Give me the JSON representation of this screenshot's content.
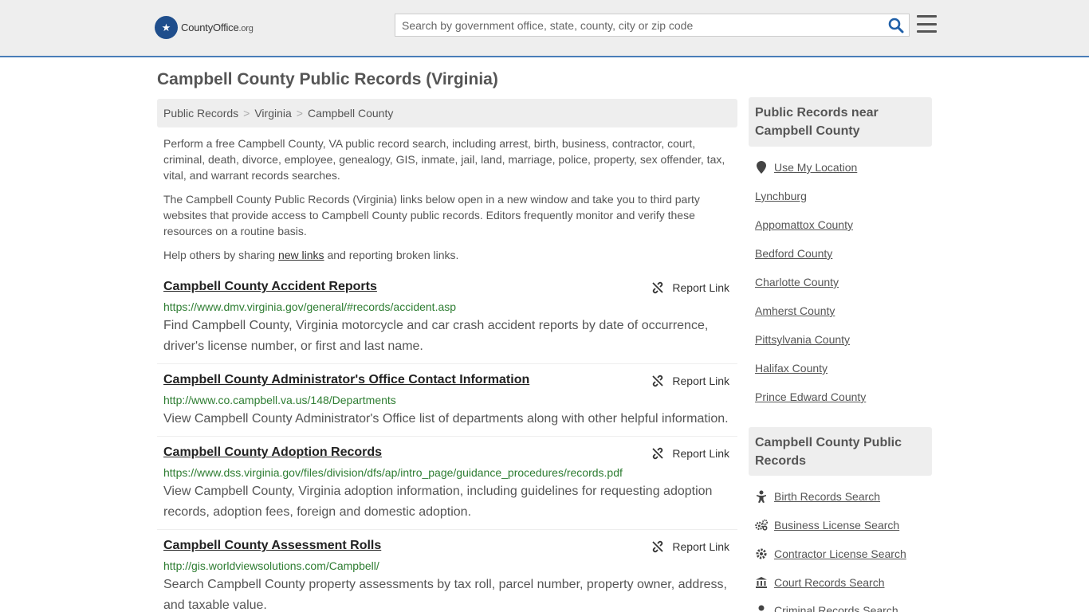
{
  "header": {
    "logo_text": "CountyOffice",
    "logo_suffix": ".org",
    "search_placeholder": "Search by government office, state, county, city or zip code"
  },
  "page_title": "Campbell County Public Records (Virginia)",
  "breadcrumb": [
    "Public Records",
    "Virginia",
    "Campbell County"
  ],
  "intro": {
    "p1": "Perform a free Campbell County, VA public record search, including arrest, birth, business, contractor, court, criminal, death, divorce, employee, genealogy, GIS, inmate, jail, land, marriage, police, property, sex offender, tax, vital, and warrant records searches.",
    "p2": "The Campbell County Public Records (Virginia) links below open in a new window and take you to third party websites that provide access to Campbell County public records. Editors frequently monitor and verify these resources on a routine basis.",
    "p3_before": "Help others by sharing ",
    "p3_link": "new links",
    "p3_after": " and reporting broken links."
  },
  "report_label": "Report Link",
  "entries": [
    {
      "title": "Campbell County Accident Reports",
      "url": "https://www.dmv.virginia.gov/general/#records/accident.asp",
      "desc": "Find Campbell County, Virginia motorcycle and car crash accident reports by date of occurrence, driver's license number, or first and last name."
    },
    {
      "title": "Campbell County Administrator's Office Contact Information",
      "url": "http://www.co.campbell.va.us/148/Departments",
      "desc": "View Campbell County Administrator's Office list of departments along with other helpful information."
    },
    {
      "title": "Campbell County Adoption Records",
      "url": "https://www.dss.virginia.gov/files/division/dfs/ap/intro_page/guidance_procedures/records.pdf",
      "desc": "View Campbell County, Virginia adoption information, including guidelines for requesting adoption records, adoption fees, foreign and domestic adoption."
    },
    {
      "title": "Campbell County Assessment Rolls",
      "url": "http://gis.worldviewsolutions.com/Campbell/",
      "desc": "Search Campbell County property assessments by tax roll, parcel number, property owner, address, and taxable value."
    }
  ],
  "sidebar": {
    "near_title": "Public Records near Campbell County",
    "use_location": "Use My Location",
    "near_links": [
      "Lynchburg",
      "Appomattox County",
      "Bedford County",
      "Charlotte County",
      "Amherst County",
      "Pittsylvania County",
      "Halifax County",
      "Prince Edward County"
    ],
    "records_title": "Campbell County Public Records",
    "record_links": [
      {
        "label": "Birth Records Search",
        "icon": "baby-icon"
      },
      {
        "label": "Business License Search",
        "icon": "gears-icon"
      },
      {
        "label": "Contractor License Search",
        "icon": "gear-icon"
      },
      {
        "label": "Court Records Search",
        "icon": "courthouse-icon"
      },
      {
        "label": "Criminal Records Search",
        "icon": "criminal-icon"
      }
    ]
  }
}
